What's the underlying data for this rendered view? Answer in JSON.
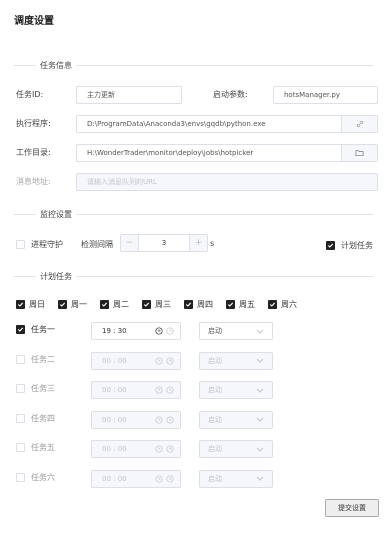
{
  "page": {
    "title": "调度设置"
  },
  "sections": {
    "task_info": "任务信息",
    "monitor": "监控设置",
    "schedule": "计划任务"
  },
  "task_info": {
    "task_id_label": "任务ID:",
    "task_id_value": "主力更新",
    "start_params_label": "启动参数:",
    "start_params_value": "hotsManager.py",
    "exe_label": "执行程序:",
    "exe_value": "D:\\ProgramData\\Anaconda3\\envs\\gqdb\\python.exe",
    "workdir_label": "工作目录:",
    "workdir_value": "H:\\WonderTrader\\monitor\\deploy\\jobs\\hotpicker",
    "msg_label": "消息地址:",
    "msg_placeholder": "请输入消息队列的URL"
  },
  "monitor": {
    "guard_label": "进程守护",
    "guard_checked": false,
    "interval_label": "检测间隔",
    "interval_value": "3",
    "interval_unit": "s",
    "minus": "−",
    "plus": "+",
    "plan_label": "计划任务",
    "plan_checked": true
  },
  "weekdays": [
    {
      "label": "周日",
      "checked": true
    },
    {
      "label": "周一",
      "checked": true
    },
    {
      "label": "周二",
      "checked": true
    },
    {
      "label": "周三",
      "checked": true
    },
    {
      "label": "周四",
      "checked": true
    },
    {
      "label": "周五",
      "checked": true
    },
    {
      "label": "周六",
      "checked": true
    }
  ],
  "tasks": [
    {
      "label": "任务一",
      "checked": true,
      "time": "19 : 30",
      "action": "启动",
      "enabled": true
    },
    {
      "label": "任务二",
      "checked": false,
      "time": "00 : 00",
      "action": "启动",
      "enabled": false
    },
    {
      "label": "任务三",
      "checked": false,
      "time": "00 : 00",
      "action": "启动",
      "enabled": false
    },
    {
      "label": "任务四",
      "checked": false,
      "time": "00 : 00",
      "action": "启动",
      "enabled": false
    },
    {
      "label": "任务五",
      "checked": false,
      "time": "00 : 00",
      "action": "启动",
      "enabled": false
    },
    {
      "label": "任务六",
      "checked": false,
      "time": "00 : 00",
      "action": "启动",
      "enabled": false
    }
  ],
  "submit_label": "提交设置"
}
